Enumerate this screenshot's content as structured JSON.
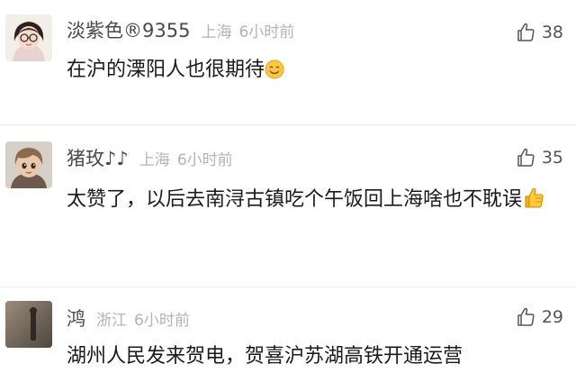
{
  "comments": [
    {
      "username": "淡紫色®9355",
      "location": "上海",
      "time": "6小时前",
      "likes": "38",
      "text": "在沪的溧阳人也很期待",
      "emoji": "smile-emoji",
      "like_icon": "thumbs-up-outline-icon"
    },
    {
      "username": "猪玫♪♪",
      "location": "上海",
      "time": "6小时前",
      "likes": "35",
      "text": "太赞了，以后去南浔古镇吃个午饭回上海啥也不耽误",
      "emoji": "thumbs-up-emoji",
      "like_icon": "thumbs-up-outline-icon"
    },
    {
      "username": "鸿",
      "location": "浙江",
      "time": "6小时前",
      "likes": "29",
      "text": "湖州人民发来贺电，贺喜沪苏湖高铁开通运营",
      "like_icon": "thumbs-up-outline-icon"
    }
  ]
}
